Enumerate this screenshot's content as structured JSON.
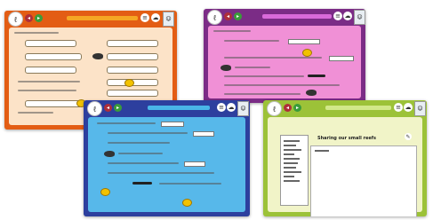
{
  "page4_title": "Sharing our small reefs"
}
